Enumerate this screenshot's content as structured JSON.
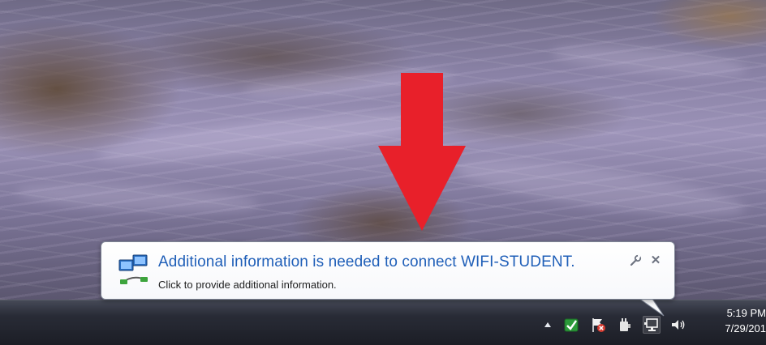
{
  "notification": {
    "title": "Additional information is needed to connect WIFI-STUDENT.",
    "body": "Click to provide additional information.",
    "icon": "network-connection-icon",
    "options_icon": "wrench-icon",
    "close_symbol": "✕"
  },
  "annotation": {
    "arrow_color": "#e8202a"
  },
  "taskbar": {
    "tray_icons": [
      "show-hidden-icons-arrow",
      "green-check-shield-icon",
      "action-center-flag-icon",
      "power-plug-icon",
      "network-icon",
      "volume-icon"
    ],
    "clock": {
      "time": "5:19 PM",
      "date": "7/29/201"
    }
  },
  "colors": {
    "title_text": "#1f5fb8",
    "body_text": "#1e1e1e",
    "balloon_border": "#7f8696"
  }
}
